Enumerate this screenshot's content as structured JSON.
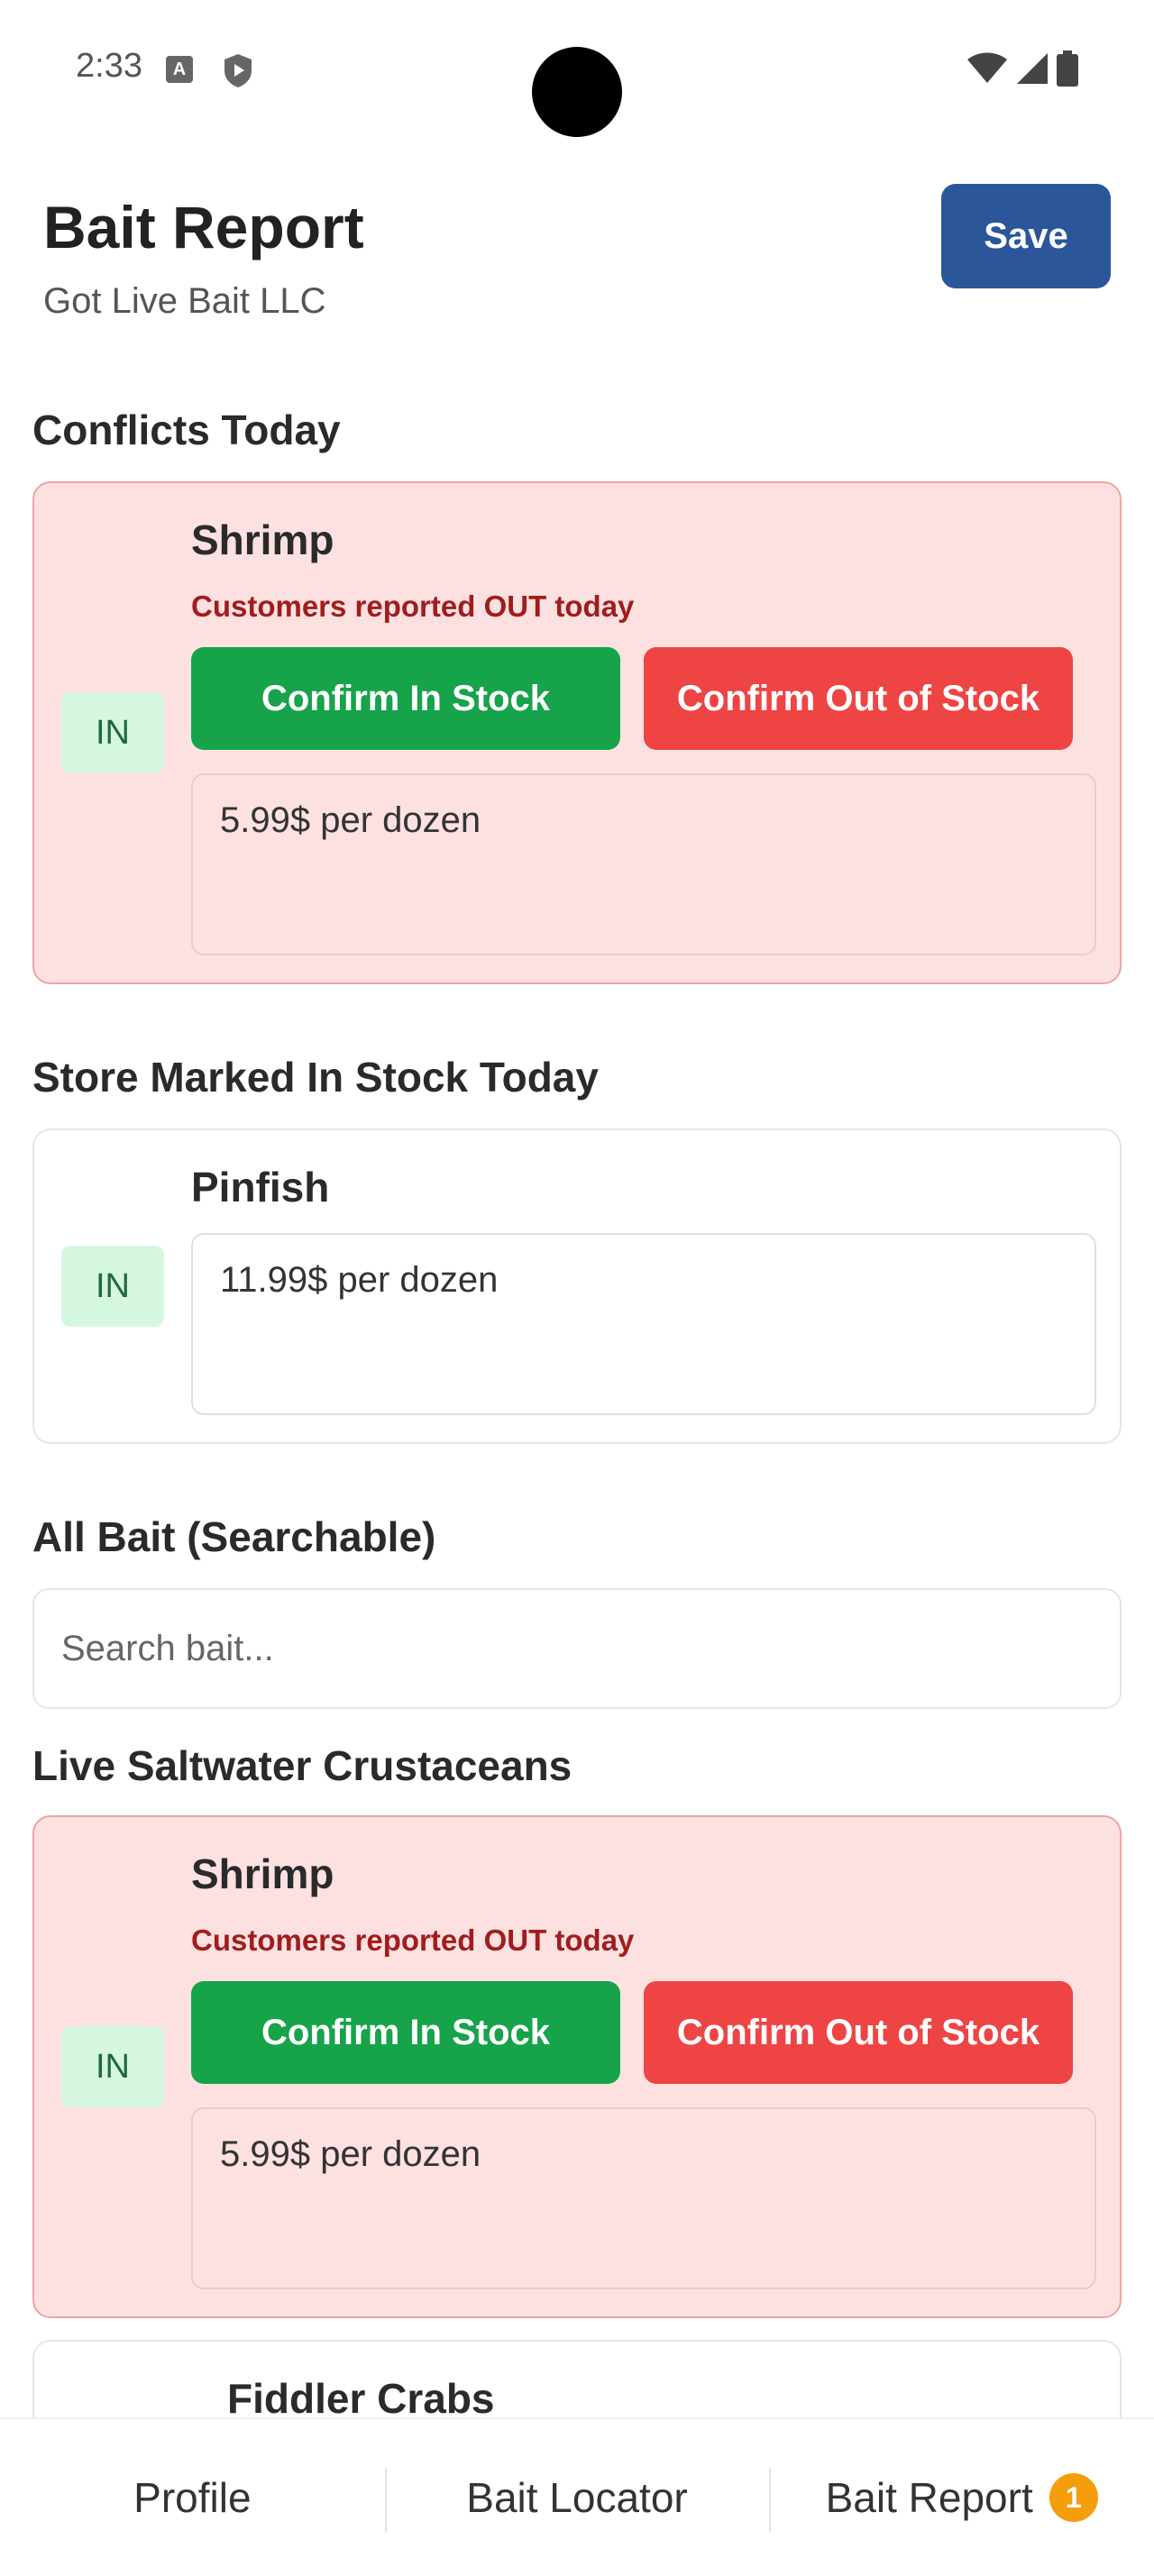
{
  "status_bar": {
    "time": "2:33",
    "icons": [
      "a-notification-icon",
      "shield-play-icon",
      "wifi-icon",
      "cellular-signal-icon",
      "battery-icon"
    ]
  },
  "header": {
    "title": "Bait Report",
    "subtitle": "Got Live Bait LLC",
    "save_label": "Save"
  },
  "sections": {
    "conflicts_title": "Conflicts Today",
    "marked_title": "Store Marked In Stock Today",
    "all_title": "All Bait (Searchable)",
    "category_title": "Live Saltwater Crustaceans"
  },
  "conflict_card": {
    "status": "IN",
    "name": "Shrimp",
    "message": "Customers reported OUT today",
    "confirm_in_label": "Confirm In Stock",
    "confirm_out_label": "Confirm Out of Stock",
    "price": "5.99$ per dozen"
  },
  "marked_card": {
    "status": "IN",
    "name": "Pinfish",
    "price": "11.99$ per dozen"
  },
  "search": {
    "placeholder": "Search bait...",
    "value": ""
  },
  "category_card": {
    "status": "IN",
    "name": "Shrimp",
    "message": "Customers reported OUT today",
    "confirm_in_label": "Confirm In Stock",
    "confirm_out_label": "Confirm Out of Stock",
    "price": "5.99$ per dozen"
  },
  "partial_card": {
    "name": "Fiddler Crabs"
  },
  "nav": {
    "profile": "Profile",
    "locator": "Bait Locator",
    "report": "Bait Report",
    "report_badge": "1"
  },
  "colors": {
    "primary": "#2b579a",
    "confirm_in": "#16a34a",
    "confirm_out": "#ef4444",
    "conflict_bg": "#fde1e1",
    "in_badge_bg": "#d6f7df",
    "nav_badge": "#f59e0b"
  }
}
